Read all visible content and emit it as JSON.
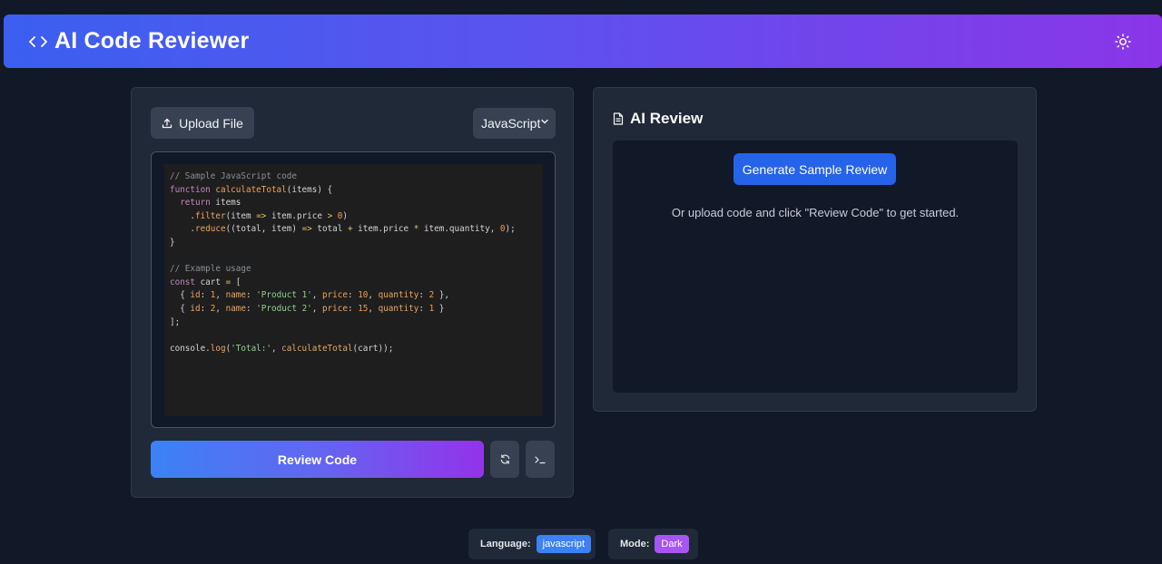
{
  "header": {
    "title": "AI Code Reviewer",
    "icon": "code-icon",
    "theme_icon": "sun-icon"
  },
  "editor_panel": {
    "upload_label": "Upload File",
    "language_selected": "JavaScript",
    "review_button": "Review Code",
    "reset_icon": "refresh-icon",
    "terminal_icon": "terminal-icon"
  },
  "review_panel": {
    "title": "AI Review",
    "title_icon": "document-icon",
    "generate_button": "Generate Sample Review",
    "hint": "Or upload code and click \"Review Code\" to get started."
  },
  "status": {
    "language_label": "Language:",
    "language_value": "javascript",
    "mode_label": "Mode:",
    "mode_value": "Dark"
  },
  "colors": {
    "background": "#111827",
    "panel": "#1f2937",
    "accent_blue": "#2563eb",
    "accent_purple": "#9333ea"
  }
}
